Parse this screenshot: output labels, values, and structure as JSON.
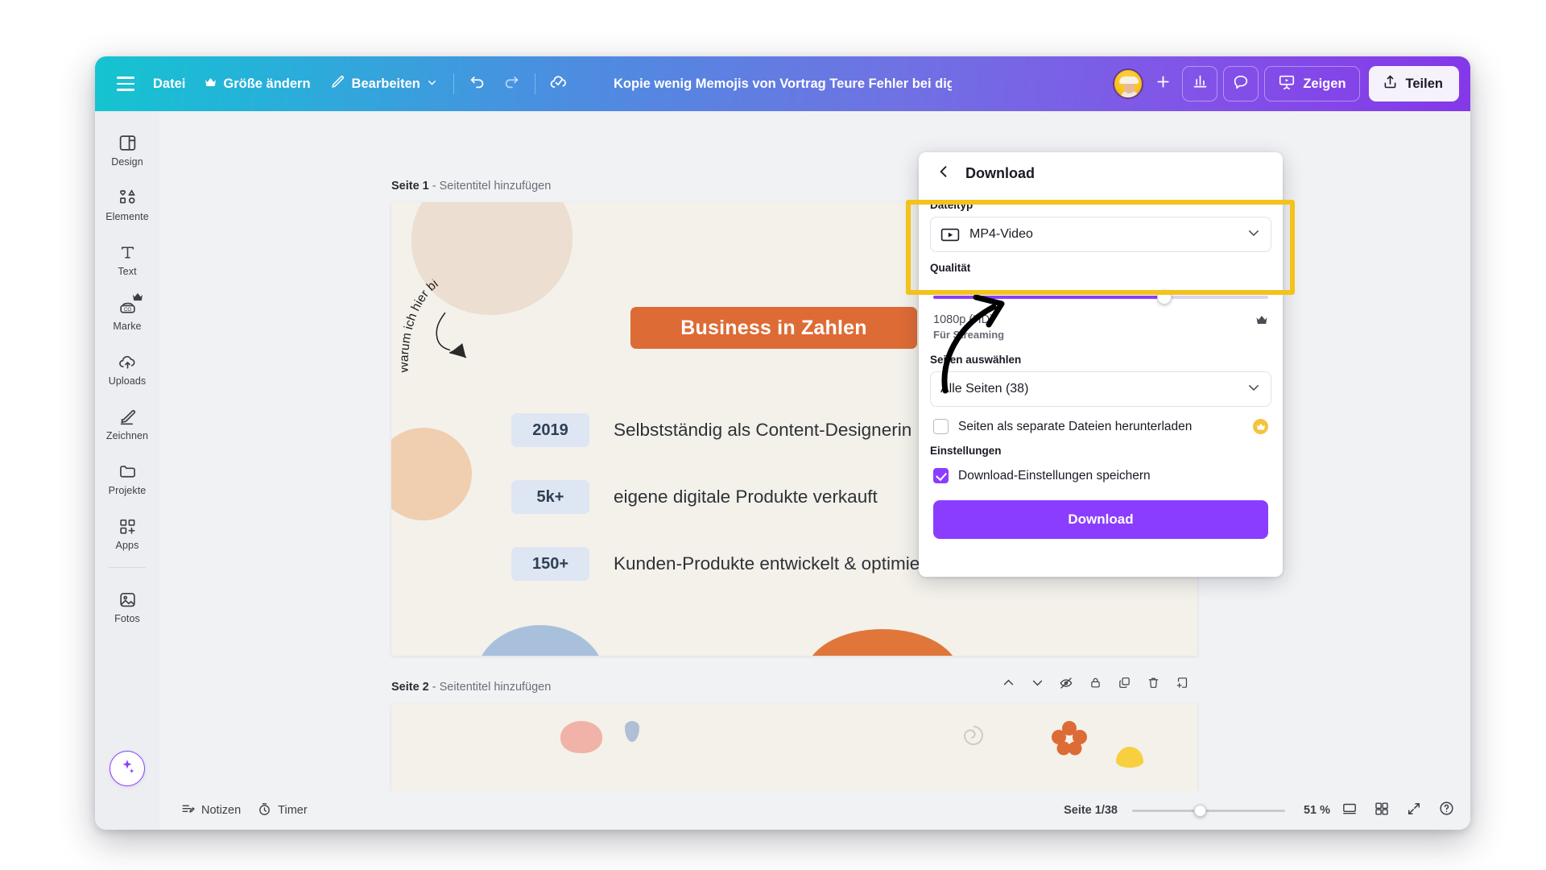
{
  "topbar": {
    "menu_icon": "hamburger-icon",
    "file_label": "Datei",
    "resize_label": "Größe ändern",
    "resize_icon": "crown-icon",
    "edit_label": "Bearbeiten",
    "edit_icon": "pencil-icon",
    "edit_chevron": "chevron-down-icon",
    "undo_icon": "undo-icon",
    "redo_icon": "redo-icon",
    "cloud_icon": "cloud-check-icon",
    "doc_title": "Kopie wenig Memojis von Vortrag Teure Fehler bei digitalen …",
    "avatar_name": "user-avatar",
    "add_collaborator_icon": "plus-icon",
    "insights_icon": "bar-chart-icon",
    "comments_icon": "comment-icon",
    "present_label": "Zeigen",
    "present_icon": "presentation-icon",
    "share_label": "Teilen",
    "share_icon": "share-upload-icon"
  },
  "sidebar": {
    "items": [
      {
        "label": "Design",
        "icon": "layout-design-icon",
        "crown": false
      },
      {
        "label": "Elemente",
        "icon": "shapes-icon",
        "crown": false
      },
      {
        "label": "Text",
        "icon": "text-T-icon",
        "crown": false
      },
      {
        "label": "Marke",
        "icon": "brand-icon",
        "crown": true
      },
      {
        "label": "Uploads",
        "icon": "cloud-upload-icon",
        "crown": false
      },
      {
        "label": "Zeichnen",
        "icon": "draw-pen-icon",
        "crown": false
      },
      {
        "label": "Projekte",
        "icon": "folder-icon",
        "crown": false
      },
      {
        "label": "Apps",
        "icon": "apps-grid-plus-icon",
        "crown": false
      }
    ],
    "bottom_item": {
      "label": "Fotos",
      "icon": "photo-icon"
    },
    "magic_button_icon": "magic-sparkle-icon"
  },
  "canvas": {
    "page1": {
      "heading_prefix": "Seite 1",
      "heading_sep": " - ",
      "heading_action": "Seitentitel hinzufügen",
      "banner_text": "Business in Zahlen",
      "handwriting": "Warum ich hier bin",
      "stats": [
        {
          "value": "2019",
          "text": "Selbstständig als Content-Designerin"
        },
        {
          "value": "5k+",
          "text": "eigene digitale Produkte verkauft"
        },
        {
          "value": "150+",
          "text": "Kunden-Produkte entwickelt & optimiert"
        }
      ]
    },
    "page2": {
      "heading_prefix": "Seite 2",
      "heading_sep": " - ",
      "heading_action": "Seitentitel hinzufügen",
      "toolbar_icons": [
        "chevron-up-icon",
        "chevron-down-icon",
        "hide-eye-icon",
        "lock-icon",
        "duplicate-icon",
        "trash-icon",
        "add-page-icon"
      ]
    }
  },
  "download_panel": {
    "back_icon": "chevron-left-icon",
    "title": "Download",
    "filetype_label": "Dateityp",
    "filetype_value": "MP4-Video",
    "filetype_icon": "video-play-icon",
    "filetype_chevron": "chevron-down-icon",
    "quality_label": "Qualität",
    "quality_resolution": "1080p (HD)",
    "quality_subtitle": "Für Streaming",
    "quality_crown_icon": "crown-icon",
    "quality_slider_percent": 69,
    "pages_label": "Seiten auswählen",
    "pages_value": "Alle Seiten (38)",
    "pages_chevron": "chevron-down-icon",
    "separate_files_label": "Seiten als separate Dateien herunterladen",
    "separate_files_checked": false,
    "separate_files_pro_icon": "crown-badge-icon",
    "settings_label": "Einstellungen",
    "save_settings_label": "Download-Einstellungen speichern",
    "save_settings_checked": true,
    "download_button_label": "Download"
  },
  "highlight": {
    "name": "filetype-highlight-box",
    "color": "#f3c21c"
  },
  "bottombar": {
    "notes_label": "Notizen",
    "notes_icon": "notes-icon",
    "timer_label": "Timer",
    "timer_icon": "timer-icon",
    "page_indicator": "Seite 1/38",
    "zoom_percent": "51 %",
    "zoom_slider_percent": 44,
    "icons": [
      "single-page-view-icon",
      "grid-view-icon",
      "fullscreen-icon",
      "help-icon"
    ]
  },
  "colors": {
    "accent_purple": "#8b3dff",
    "highlight_yellow": "#f3c21c",
    "banner_orange": "#dd6b36",
    "canvas_bg": "#f3f1ea",
    "rail_bg": "#eceef1"
  }
}
